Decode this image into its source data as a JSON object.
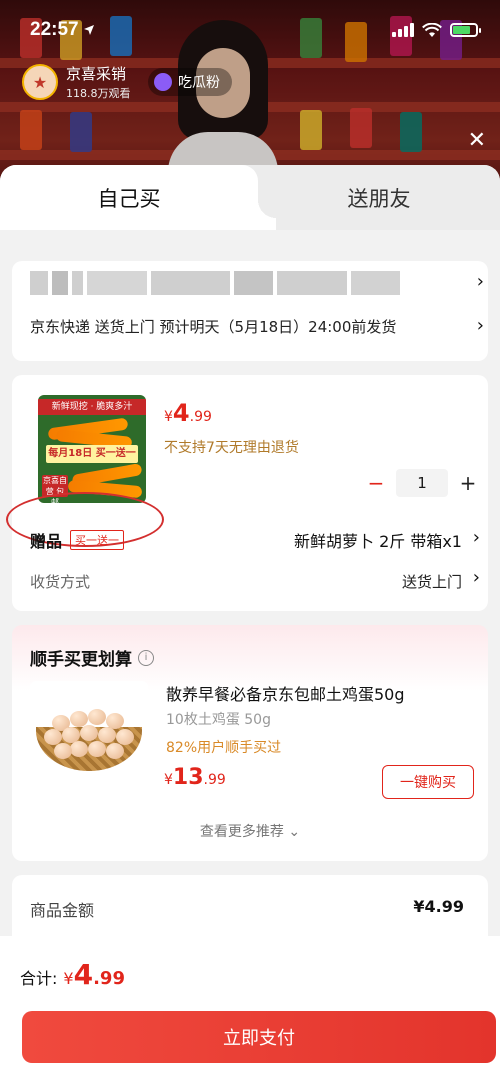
{
  "status_bar": {
    "time": "22:57"
  },
  "stream": {
    "streamer_name": "京喜采销",
    "viewers": "118.8万观看",
    "follow_label": "吃瓜粉"
  },
  "tabs": [
    {
      "label": "自己买",
      "active": true
    },
    {
      "label": "送朋友",
      "active": false
    }
  ],
  "address": {
    "delivery_line": "京东快递 送货上门 预计明天（5月18日）24:00前发货"
  },
  "product": {
    "image_band": "新鲜现挖 · 脆爽多汁",
    "image_promo": "每月18日 买一送一",
    "image_badge": "京喜自营 包邮",
    "price_currency": "¥",
    "price_int": "4",
    "price_dec": ".99",
    "return_policy": "不支持7天无理由退货",
    "quantity": "1",
    "gift_label": "赠品",
    "gift_tag": "买一送一",
    "gift_name": "新鲜胡萝卜 2斤 带箱x1",
    "shipping_label": "收货方式",
    "shipping_value": "送货上门"
  },
  "recommend": {
    "title": "顺手买更划算",
    "item_name": "散养早餐必备京东包邮土鸡蛋50g",
    "item_sub": "10枚土鸡蛋 50g",
    "item_bought": "82%用户顺手买过",
    "price_currency": "¥",
    "price_int": "13",
    "price_dec": ".99",
    "buy_label": "一键购买",
    "more_label": "查看更多推荐 ⌄"
  },
  "summary": {
    "label": "商品金额",
    "value": "¥4.99"
  },
  "bottom": {
    "total_label": "合计:",
    "price_currency": "¥",
    "price_int": "4",
    "price_dec": ".99",
    "pay_label": "立即支付"
  },
  "colors": {
    "accent": "#e1251b",
    "gold": "#b07a2a",
    "pay_button": "#f04a3e"
  }
}
